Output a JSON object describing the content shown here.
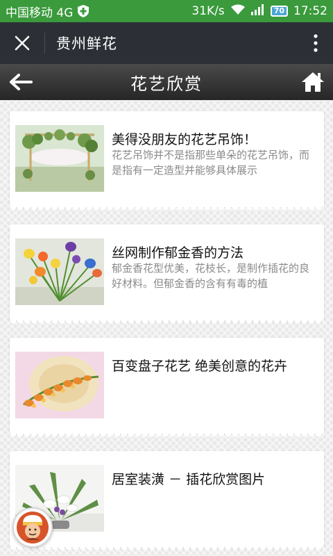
{
  "status_bar": {
    "carrier": "中国移动 4G",
    "speed": "31K/s",
    "battery": "70",
    "time": "17:52"
  },
  "top_nav": {
    "title": "贵州鲜花"
  },
  "title_bar": {
    "title": "花艺欣赏"
  },
  "articles": [
    {
      "title": "美得没朋友的花艺吊饰！",
      "description": "花艺吊饰并不是指那些单朵的花艺吊饰，而是指有一定造型并能够具体展示"
    },
    {
      "title": "丝网制作郁金香的方法",
      "description": "郁金香花型优美，花枝长，是制作插花的良好材料。但郁金香的含有有毒的植"
    },
    {
      "title": "百变盘子花艺 绝美创意的花卉",
      "description": ""
    },
    {
      "title": "居室装潢 － 插花欣赏图片",
      "description": ""
    }
  ],
  "colors": {
    "status_bar": "#3a9a3c",
    "top_nav": "#2c3036",
    "title_bar": "#333333"
  }
}
